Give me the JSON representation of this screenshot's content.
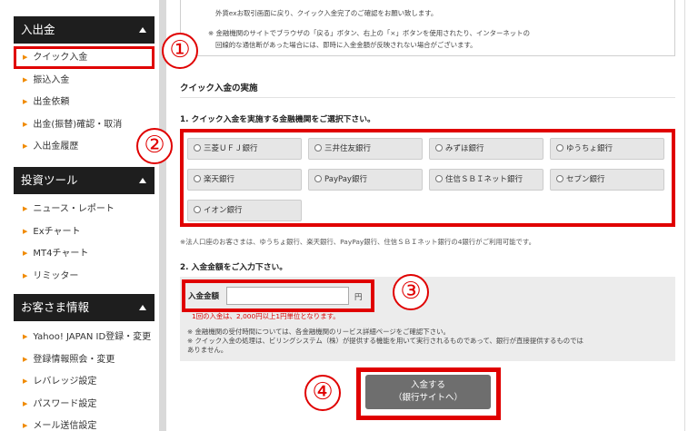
{
  "sidebar": {
    "deposit": {
      "title": "入出金",
      "items": [
        {
          "label": "クイック入金"
        },
        {
          "label": "振込入金"
        },
        {
          "label": "出金依頼"
        },
        {
          "label": "出金(振替)確認・取消"
        },
        {
          "label": "入出金履歴"
        }
      ]
    },
    "tools": {
      "title": "投資ツール",
      "items": [
        {
          "label": "ニュース・レポート"
        },
        {
          "label": "Exチャート"
        },
        {
          "label": "MT4チャート"
        },
        {
          "label": "リミッター"
        }
      ]
    },
    "customer": {
      "title": "お客さま情報",
      "items": [
        {
          "label": "Yahoo! JAPAN ID登録・変更"
        },
        {
          "label": "登録情報照会・変更"
        },
        {
          "label": "レバレッジ設定"
        },
        {
          "label": "パスワード設定"
        },
        {
          "label": "メール送信設定"
        }
      ]
    }
  },
  "notice": {
    "line1": "外貨exお取引画面に戻り、クイック入金完了のご確認をお願い致します。",
    "line2": "※ 金融機関のサイトでブラウザの「戻る」ボタン、右上の「×」ボタンを使用されたり、インターネットの",
    "line3": "回線的な通信断があった場合には、即時に入金金額が反映されない場合がございます。"
  },
  "quick_title": "クイック入金の実施",
  "step1_title": "1. クイック入金を実施する金融機関をご選択下さい。",
  "banks": [
    {
      "label": "三菱ＵＦＪ銀行"
    },
    {
      "label": "三井住友銀行"
    },
    {
      "label": "みずほ銀行"
    },
    {
      "label": "ゆうちょ銀行"
    },
    {
      "label": "楽天銀行"
    },
    {
      "label": "PayPay銀行"
    },
    {
      "label": "住信ＳＢＩネット銀行"
    },
    {
      "label": "セブン銀行"
    },
    {
      "label": "イオン銀行"
    }
  ],
  "corp_note": "※法人口座のお客さまは、ゆうちょ銀行、楽天銀行、PayPay銀行、住信ＳＢＩネット銀行の4銀行がご利用可能です。",
  "step2_title": "2. 入金金額をご入力下さい。",
  "amount": {
    "label": "入金金額",
    "value": "",
    "unit": "円",
    "min_note": "1回の入金は、2,000円以上1円単位となります。",
    "note1": "※ 金融機関の受付時間については、各金融機関のリービス詳細ページをご確認下さい。",
    "note2": "※ クイック入金の処理は、ビリングシステム（株）が提供する機能を用いて実行されるものであって、銀行が直接提供するものでは",
    "note3": "ありません。"
  },
  "submit": {
    "line1": "入金する",
    "line2": "（銀行サイトへ）"
  },
  "steps": {
    "s1": "①",
    "s2": "②",
    "s3": "③",
    "s4": "④"
  },
  "colors": {
    "highlight": "#e00000",
    "sidebar_header": "#1e1e1e",
    "bullet": "#f08a00",
    "submit": "#6e6e6e"
  }
}
